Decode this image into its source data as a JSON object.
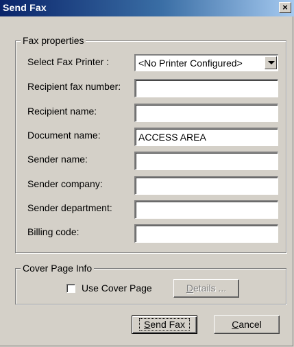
{
  "window": {
    "title": "Send Fax",
    "close_glyph": "×"
  },
  "fax_properties": {
    "legend": "Fax properties",
    "printer_label": "Select Fax Printer :",
    "printer_value": "<No Printer Configured>",
    "recipient_fax_label": "Recipient fax number:",
    "recipient_fax_value": "",
    "recipient_name_label": "Recipient name:",
    "recipient_name_value": "",
    "document_name_label": "Document name:",
    "document_name_value": "ACCESS AREA",
    "sender_name_label": "Sender name:",
    "sender_name_value": "",
    "sender_company_label": "Sender company:",
    "sender_company_value": "",
    "sender_department_label": "Sender department:",
    "sender_department_value": "",
    "billing_code_label": "Billing code:",
    "billing_code_value": ""
  },
  "cover_page": {
    "legend": "Cover Page Info",
    "use_cover_label": "Use Cover Page",
    "use_cover_checked": false,
    "details_label_mnemonic": "D",
    "details_label_rest": "etails ..."
  },
  "buttons": {
    "send_mnemonic": "S",
    "send_rest": "end Fax",
    "cancel_mnemonic": "C",
    "cancel_rest": "ancel"
  },
  "icons": {
    "close": "close-icon",
    "dropdown": "chevron-down-icon"
  }
}
